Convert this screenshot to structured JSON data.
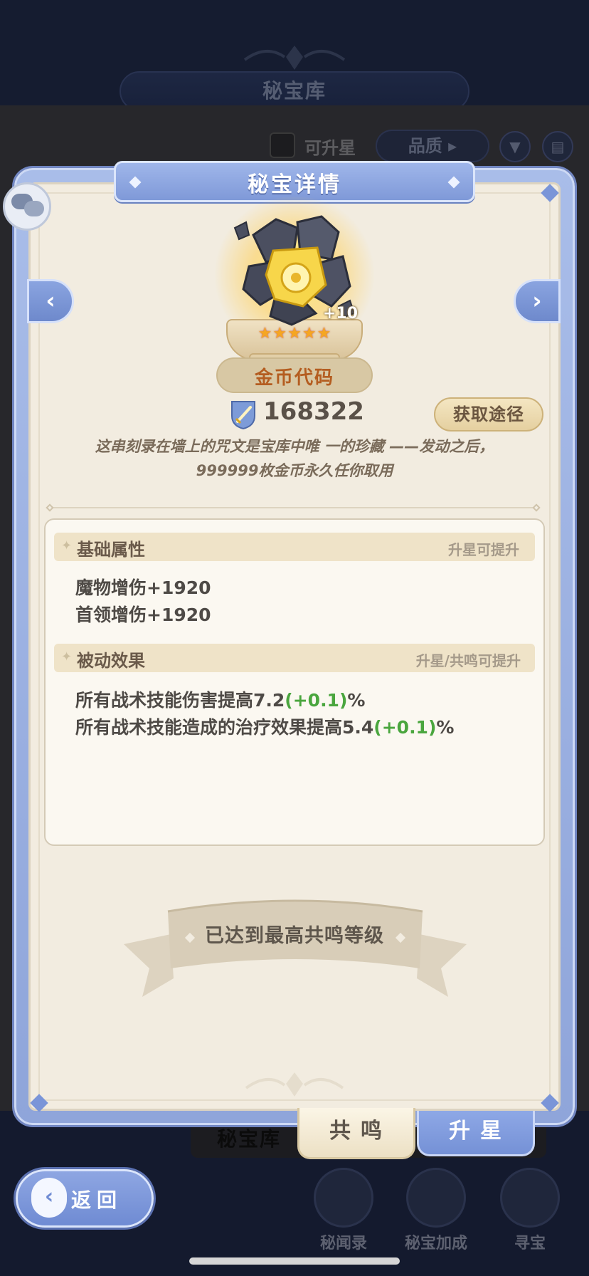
{
  "background": {
    "screen_title": "秘宝库",
    "filter_upgradable": "可升星",
    "quality_select": "品质",
    "quality_arrow": "▸",
    "tab_vault": "秘宝库",
    "nav": [
      {
        "label": "秘闻录",
        "icon": "book-stack-icon"
      },
      {
        "label": "秘宝加成",
        "icon": "arrow-up-icon"
      },
      {
        "label": "寻宝",
        "icon": "treasure-chest-icon"
      }
    ]
  },
  "modal": {
    "title": "秘宝详情",
    "prev_arrow": "‹",
    "next_arrow": "›",
    "item": {
      "name": "金币代码",
      "level": "+10",
      "stars": 5,
      "power": "168322",
      "description_line1": "这串刻录在墙上的咒文是宝库中唯 一的珍藏 ——发动之后，",
      "description_line2": "999999枚金币永久任你取用"
    },
    "obtain_button": "获取途径",
    "sections": {
      "basic": {
        "title": "基础属性",
        "hint": "升星可提升",
        "lines": [
          "魔物增伤+1920",
          "首领增伤+1920"
        ]
      },
      "passive": {
        "title": "被动效果",
        "hint": "升星/共鸣可提升",
        "lines": [
          {
            "text": "所有战术技能伤害提高7.2",
            "bonus": "(+0.1)",
            "suffix": "%"
          },
          {
            "text": "所有战术技能造成的治疗效果提高5.4",
            "bonus": "(+0.1)",
            "suffix": "%"
          }
        ]
      }
    },
    "max_level_ribbon": "已达到最高共鸣等级",
    "tabs": {
      "resonate": "共鸣",
      "star_up": "升星"
    }
  },
  "back_button": {
    "arrow": "‹",
    "label": "返回"
  },
  "colors": {
    "accent_blue": "#7f99d8",
    "name_orange": "#b45d20",
    "bonus_green": "#4aa63e",
    "star_gold": "#f5a623"
  }
}
